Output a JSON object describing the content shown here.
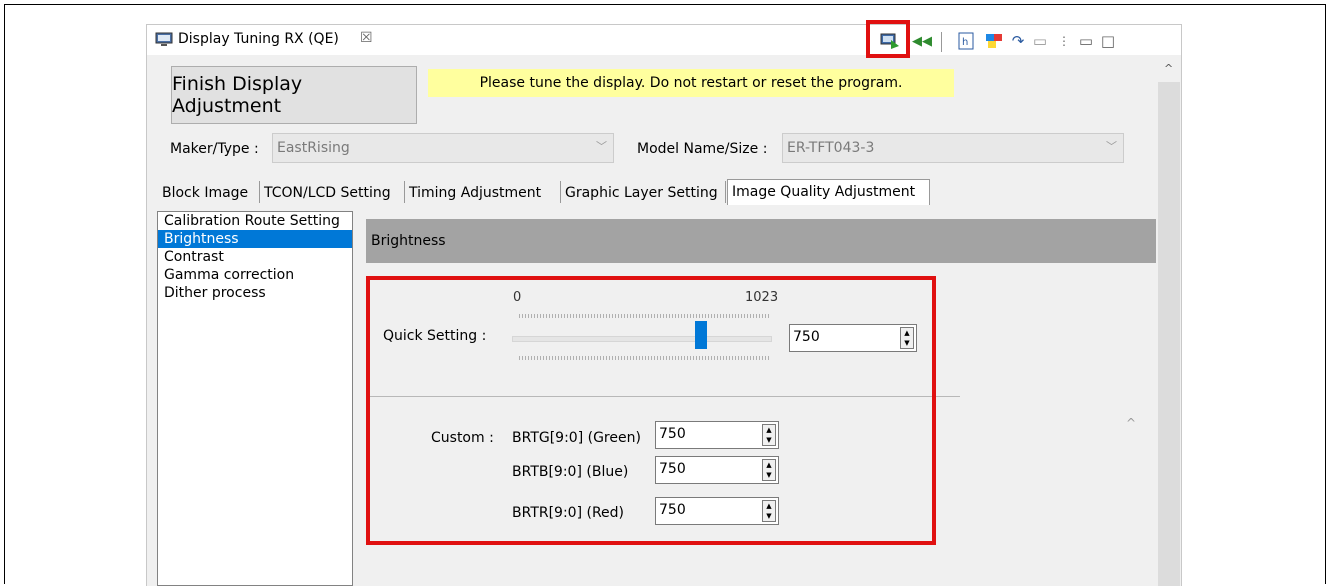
{
  "window": {
    "tab_title": "Display Tuning RX (QE)",
    "close_glyph": "☒",
    "toolbar_icons": [
      "monitor-arrow-icon",
      "rewind-icon",
      "h-document-icon",
      "palette-icon",
      "redo-icon",
      "layout-icon",
      "view-menu-icon",
      "minimize-icon",
      "maximize-icon"
    ]
  },
  "header": {
    "finish_label": "Finish Display Adjustment",
    "notice": "Please tune the display. Do not restart or reset the program."
  },
  "selectors": {
    "maker_label": "Maker/Type :",
    "maker_value": "EastRising",
    "model_label": "Model Name/Size :",
    "model_value": "ER-TFT043-3"
  },
  "tabs": [
    "Block Image",
    "TCON/LCD Setting",
    "Timing Adjustment",
    "Graphic Layer Setting",
    "Image Quality Adjustment"
  ],
  "active_tab": "Image Quality Adjustment",
  "left_list": [
    "Calibration Route Setting",
    "Brightness",
    "Contrast",
    "Gamma correction",
    "Dither process"
  ],
  "selected_item": "Brightness",
  "section_title": "Brightness",
  "quick": {
    "label": "Quick Setting :",
    "min": "0",
    "max": "1023",
    "value": "750",
    "slider_fraction": 0.733
  },
  "custom": {
    "label": "Custom :",
    "fields": [
      {
        "name": "BRTG[9:0] (Green)",
        "value": "750"
      },
      {
        "name": "BRTB[9:0] (Blue)",
        "value": "750"
      },
      {
        "name": "BRTR[9:0] (Red)",
        "value": "750"
      }
    ]
  },
  "colors": {
    "highlight": "#e01010",
    "selection": "#0078d7",
    "notice_bg": "#ffff9e"
  }
}
